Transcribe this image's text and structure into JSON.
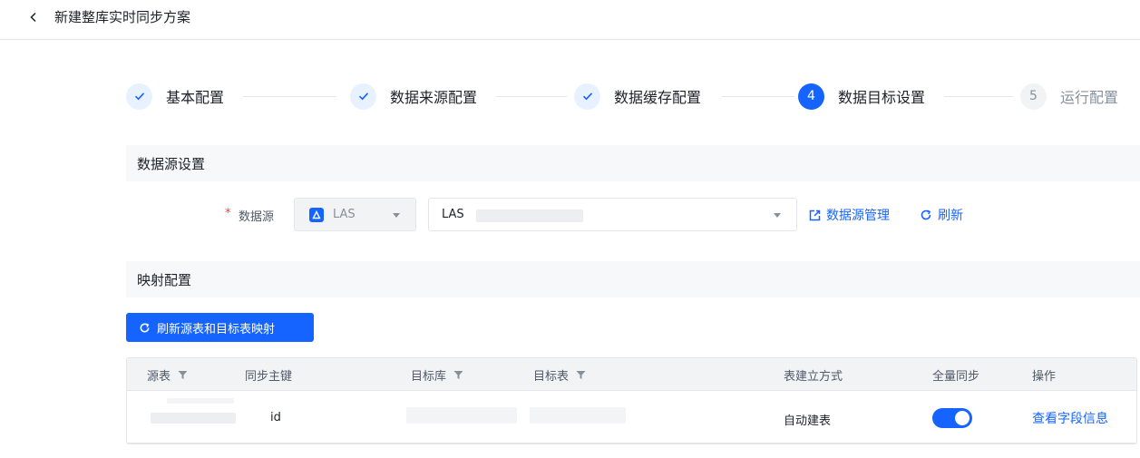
{
  "header": {
    "back_icon": "chevron-left-icon",
    "title": "新建整库实时同步方案"
  },
  "steps": [
    {
      "label": "基本配置",
      "status": "done",
      "number": "1"
    },
    {
      "label": "数据来源配置",
      "status": "done",
      "number": "2"
    },
    {
      "label": "数据缓存配置",
      "status": "done",
      "number": "3"
    },
    {
      "label": "数据目标设置",
      "status": "active",
      "number": "4"
    },
    {
      "label": "运行配置",
      "status": "pending",
      "number": "5"
    }
  ],
  "datasource_section": {
    "title": "数据源设置",
    "required_mark": "*",
    "label": "数据源",
    "type_value": "LAS",
    "source_value": "LAS",
    "manage_label": "数据源管理",
    "refresh_label": "刷新"
  },
  "mapping_section": {
    "title": "映射配置",
    "refresh_mapping_label": "刷新源表和目标表映射"
  },
  "table": {
    "columns": [
      "源表",
      "同步主键",
      "目标库",
      "目标表",
      "表建立方式",
      "全量同步",
      "操作"
    ],
    "rows": [
      {
        "primary_key": "id",
        "create_mode": "自动建表",
        "full_sync": true,
        "action": "查看字段信息"
      }
    ]
  },
  "colors": {
    "primary": "#1664ff",
    "step_done_bg": "#e8f1ff",
    "section_bg": "#f7f8fa",
    "required": "#f53f3f"
  }
}
